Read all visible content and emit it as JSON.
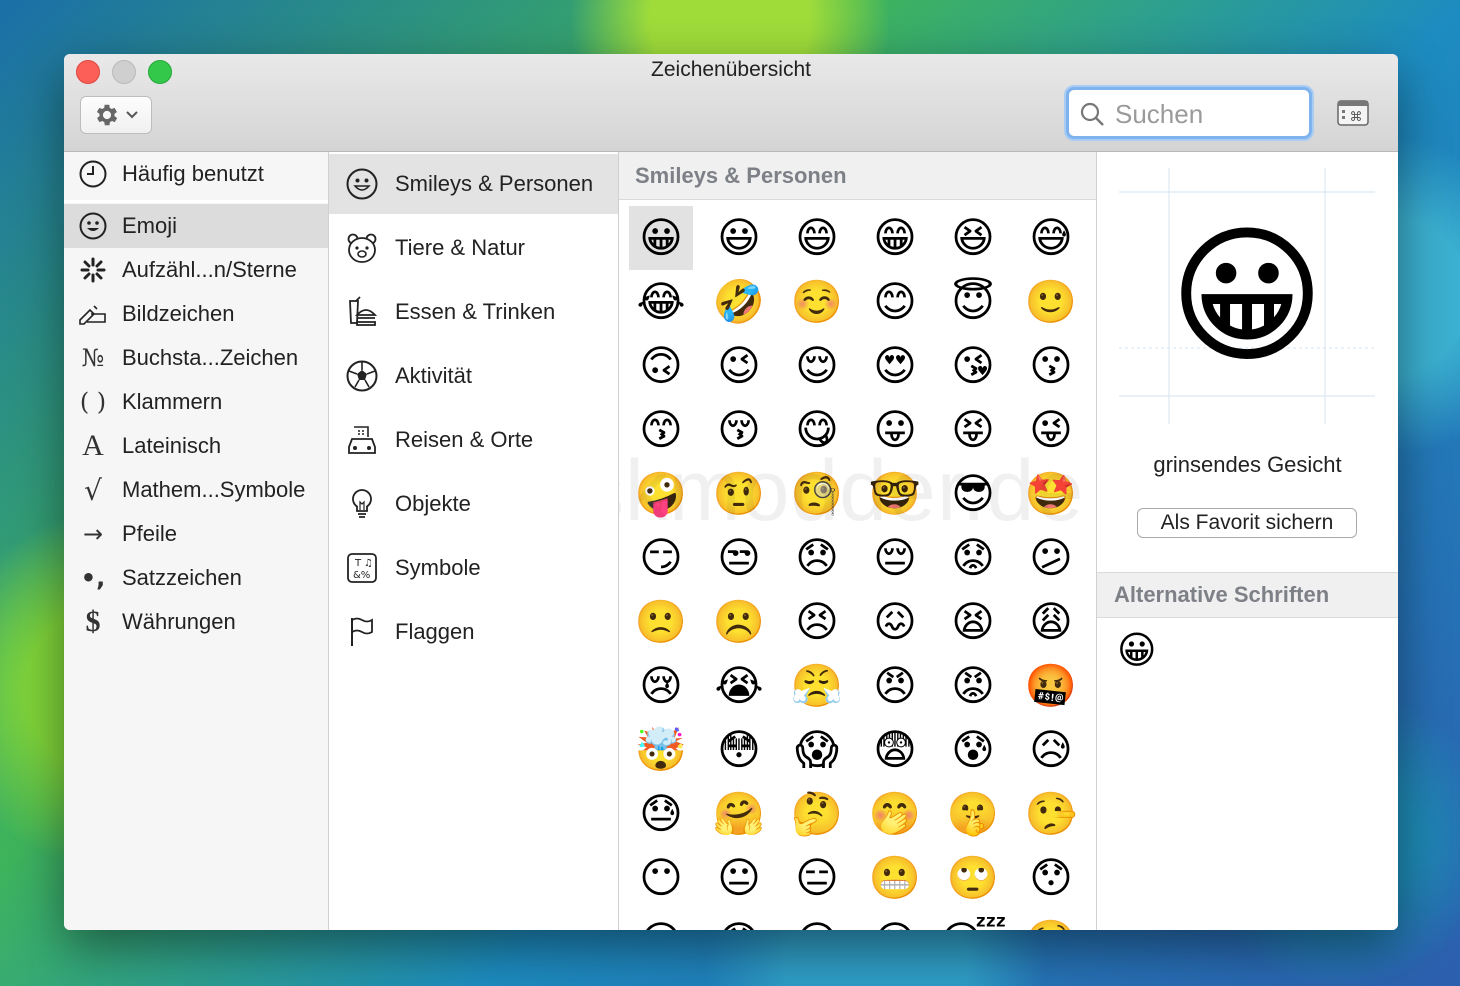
{
  "window": {
    "title": "Zeichenübersicht"
  },
  "toolbar": {
    "search_placeholder": "Suchen"
  },
  "col1": {
    "items": [
      {
        "label": "Häufig benutzt",
        "icon": "clock-icon"
      },
      {
        "label": "Emoji",
        "icon": "smiley-icon",
        "selected": true
      },
      {
        "label": "Aufzähl...n/Sterne",
        "icon": "asterisk-icon"
      },
      {
        "label": "Bildzeichen",
        "icon": "writing-hand-icon"
      },
      {
        "label": "Buchsta...Zeichen",
        "icon": "numero-icon",
        "glyph": "№"
      },
      {
        "label": "Klammern",
        "icon": "parentheses-icon",
        "glyph": "( )"
      },
      {
        "label": "Lateinisch",
        "icon": "latin-a-icon",
        "glyph": "A"
      },
      {
        "label": "Mathem...Symbole",
        "icon": "square-root-icon",
        "glyph": "√"
      },
      {
        "label": "Pfeile",
        "icon": "arrow-right-icon",
        "glyph": "→"
      },
      {
        "label": "Satzzeichen",
        "icon": "punctuation-icon",
        "glyph": "•,"
      },
      {
        "label": "Währungen",
        "icon": "dollar-icon",
        "glyph": "$"
      }
    ]
  },
  "col2": {
    "items": [
      {
        "label": "Smileys & Personen",
        "icon": "smiley-outline-icon",
        "selected": true
      },
      {
        "label": "Tiere & Natur",
        "icon": "bear-icon"
      },
      {
        "label": "Essen & Trinken",
        "icon": "burger-drink-icon"
      },
      {
        "label": "Aktivität",
        "icon": "soccer-ball-icon"
      },
      {
        "label": "Reisen & Orte",
        "icon": "car-building-icon"
      },
      {
        "label": "Objekte",
        "icon": "lightbulb-icon"
      },
      {
        "label": "Symbole",
        "icon": "symbols-icon"
      },
      {
        "label": "Flaggen",
        "icon": "flag-icon"
      }
    ]
  },
  "grid": {
    "header": "Smileys & Personen",
    "emojis": [
      "😀",
      "😃",
      "😄",
      "😁",
      "😆",
      "😅",
      "😂",
      "🤣",
      "☺️",
      "😊",
      "😇",
      "🙂",
      "🙃",
      "😉",
      "😌",
      "😍",
      "😘",
      "😗",
      "😙",
      "😚",
      "😋",
      "😛",
      "😝",
      "😜",
      "🤪",
      "🤨",
      "🧐",
      "🤓",
      "😎",
      "🤩",
      "😏",
      "😒",
      "😞",
      "😔",
      "😟",
      "😕",
      "🙁",
      "☹️",
      "😣",
      "😖",
      "😫",
      "😩",
      "😢",
      "😭",
      "😤",
      "😠",
      "😡",
      "🤬",
      "🤯",
      "😳",
      "😱",
      "😨",
      "😰",
      "😥",
      "😓",
      "🤗",
      "🤔",
      "🤭",
      "🤫",
      "🤥",
      "😶",
      "😐",
      "😑",
      "😬",
      "🙄",
      "😯",
      "😦",
      "😧",
      "😮",
      "😲",
      "😴",
      "🤤"
    ]
  },
  "detail": {
    "preview_emoji": "😀",
    "name": "grinsendes Gesicht",
    "favorite_button": "Als Favorit sichern",
    "alt_fonts_header": "Alternative Schriften",
    "alt_emoji": "😀"
  },
  "watermark": "Deskmodder.de"
}
